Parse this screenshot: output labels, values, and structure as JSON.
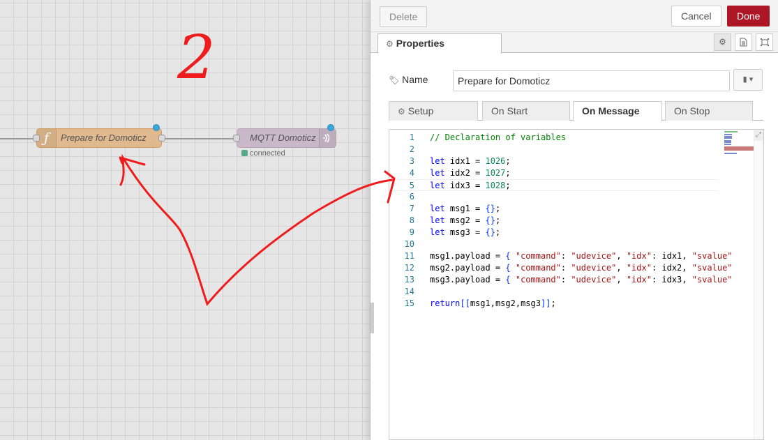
{
  "workspace": {
    "function_node": {
      "icon": "function-icon",
      "label": "Prepare for Domoticz"
    },
    "mqtt_node": {
      "icon": "mqtt-wireless-icon",
      "label": "MQTT Domoticz",
      "status": "connected",
      "status_color": "#55aa88"
    },
    "annotation_text": "2"
  },
  "toolbar": {
    "delete_label": "Delete",
    "cancel_label": "Cancel",
    "done_label": "Done",
    "done_color": "#ad1625"
  },
  "properties_tab": {
    "label": "Properties",
    "icon": "gear-icon"
  },
  "tab_icons": [
    "gear-icon",
    "file-text-icon",
    "appearance-icon"
  ],
  "name_field": {
    "label": "Name",
    "icon": "tag-icon",
    "value": "Prepare for Domoticz"
  },
  "code_tabs": [
    {
      "label": "Setup",
      "icon": "gear-icon"
    },
    {
      "label": "On Start"
    },
    {
      "label": "On Message",
      "active": true
    },
    {
      "label": "On Stop"
    }
  ],
  "code": {
    "line_numbers": [
      "1",
      "2",
      "3",
      "4",
      "5",
      "6",
      "7",
      "8",
      "9",
      "10",
      "11",
      "12",
      "13",
      "14",
      "15"
    ],
    "lines": [
      "// Declaration of variables",
      "",
      "let idx1 = 1026;",
      "let idx2 = 1027;",
      "let idx3 = 1028;",
      "",
      "let msg1 = {};",
      "let msg2 = {};",
      "let msg3 = {};",
      "",
      "msg1.payload = { \"command\": \"udevice\", \"idx\": idx1, \"svalue\"",
      "msg2.payload = { \"command\": \"udevice\", \"idx\": idx2, \"svalue\"",
      "msg3.payload = { \"command\": \"udevice\", \"idx\": idx3, \"svalue\"",
      "",
      "return[[msg1,msg2,msg3]];"
    ],
    "current_line": 5
  }
}
